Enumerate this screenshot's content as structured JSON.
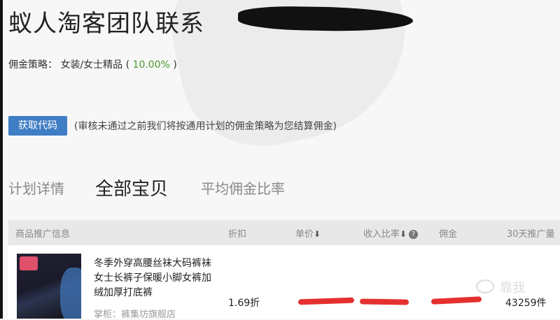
{
  "header": {
    "title": "蚁人淘客团队联系"
  },
  "commission": {
    "label": "佣金策略：",
    "category": "女装/女士精品",
    "open_paren": "(",
    "rate": "10.00%",
    "close_paren": ")"
  },
  "action": {
    "get_code_label": "获取代码",
    "note": "(审核未通过之前我们将按通用计划的佣金策略为您结算佣金)"
  },
  "tabs": [
    {
      "label": "计划详情",
      "active": false
    },
    {
      "label": "全部宝贝",
      "active": true
    },
    {
      "label": "平均佣金比率",
      "active": false
    }
  ],
  "table": {
    "headers": [
      "商品推广信息",
      "折扣",
      "单价",
      "收入比率",
      "佣金",
      "30天推广量"
    ],
    "rows": [
      {
        "title": "冬季外穿高腰丝袜大码裤袜女士长裤子保暖小脚女裤加绒加厚打底裤",
        "shop": "掌柜：裤集坊旗舰店",
        "discount": "1.69折",
        "sales": "43259件"
      }
    ]
  },
  "watermark": {
    "text": "靠我"
  },
  "colors": {
    "button": "#3f7dc4",
    "rate": "#4a9a2a",
    "redaction": "#e53030"
  }
}
